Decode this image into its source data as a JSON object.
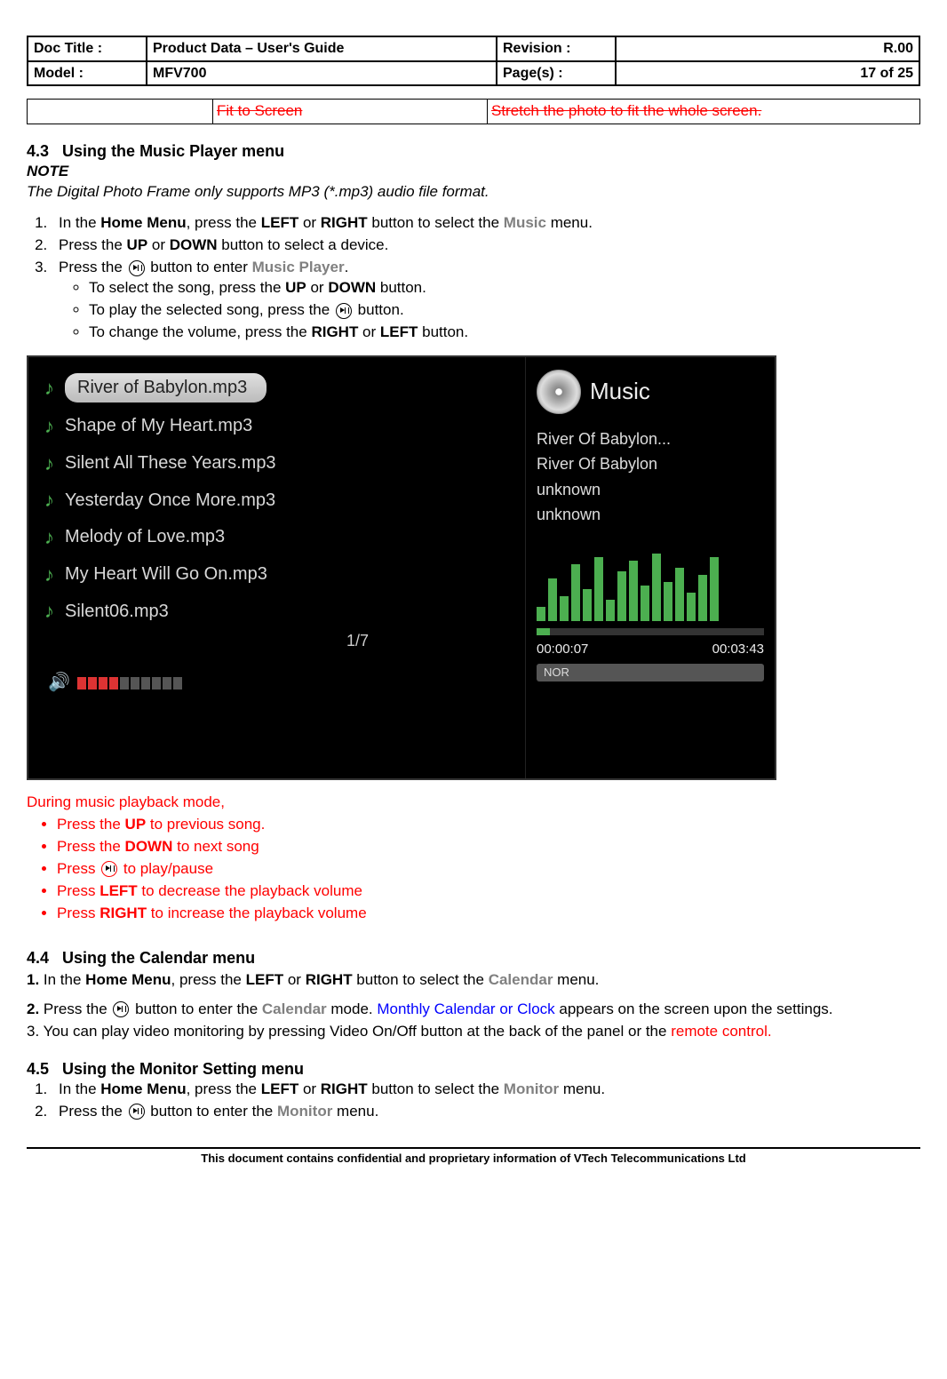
{
  "header": {
    "docTitleLbl": "Doc Title    :",
    "docTitleVal": "Product Data – User's Guide",
    "modelLbl": "Model         :",
    "modelVal": "MFV700",
    "revLbl": "Revision  :",
    "revVal": "R.00",
    "pagesLbl": "Page(s)   :",
    "pagesVal": "17 of 25"
  },
  "fitTable": {
    "col1": " ",
    "col2": "Fit to Screen",
    "col3": "Stretch the photo to fit the whole screen."
  },
  "s43": {
    "title_num": "4.3",
    "title_rest_a": "Using ",
    "title_rest_b": "the Music Player menu",
    "noteHead": "NOTE",
    "noteBody": "The Digital Photo Frame only supports MP3 (*.mp3) audio file format.",
    "step1_a": "In the ",
    "step1_b": "Home Menu",
    "step1_c": ", press the ",
    "step1_d": "LEFT",
    "step1_e": " or ",
    "step1_f": "RIGHT",
    "step1_g": " button to select the ",
    "step1_h": "Music",
    "step1_i": " menu.",
    "step2_a": "Press the ",
    "step2_b": "UP",
    "step2_c": " or ",
    "step2_d": "DOWN",
    "step2_e": " button to select a device.",
    "step3_a": "Press the ",
    "step3_b": " button to enter ",
    "step3_c": "Music Player",
    "step3_d": ".",
    "b1_a": "To select the song, press the ",
    "b1_b": "UP",
    "b1_c": " or ",
    "b1_d": "DOWN",
    "b1_e": " button.",
    "b2_a": "To play the selected song, press the ",
    "b2_b": " button.",
    "b3_a": "To change the volume, press the ",
    "b3_b": "RIGHT",
    "b3_c": " or ",
    "b3_d": "LEFT",
    "b3_e": " button."
  },
  "player": {
    "songs": [
      "River of Babylon.mp3",
      "Shape of My Heart.mp3",
      "Silent All These Years.mp3",
      "Yesterday Once More.mp3",
      "Melody of Love.mp3",
      "My Heart Will Go On.mp3",
      "Silent06.mp3"
    ],
    "pageInd": "1/7",
    "panelTitle": "Music",
    "info1": "River Of Babylon...",
    "info2": "River Of Babylon",
    "info3": "unknown",
    "info4": "unknown",
    "t_elapsed": "00:00:07",
    "t_total": "00:03:43",
    "mode": "NOR"
  },
  "during": {
    "lead": "During music playback mode,",
    "b1_a": "Press the ",
    "b1_b": "UP",
    "b1_c": " to previous song.",
    "b2_a": "Press the ",
    "b2_b": "DOWN",
    "b2_c": " to next song",
    "b3_a": "Press ",
    "b3_b": " to play/pause",
    "b4_a": "Press ",
    "b4_b": "LEFT",
    "b4_c": " to decrease the playback volume",
    "b5_a": "Press ",
    "b5_b": "RIGHT",
    "b5_c": " to increase the playback volume"
  },
  "s44": {
    "title_num": "4.4",
    "title_rest": "Using the Calendar menu",
    "l1_a": "1. ",
    "l1_b": "In the ",
    "l1_c": "Home Menu",
    "l1_d": ", press the ",
    "l1_e": "LEFT",
    "l1_f": " or ",
    "l1_g": "RIGHT",
    "l1_h": " button to select the ",
    "l1_i": "Calendar",
    "l1_j": " menu.",
    "l2_a": "2. ",
    "l2_b": "Press the ",
    "l2_c": " button to enter the ",
    "l2_d": "Calendar",
    "l2_e": " mode. ",
    "l2_f": "Monthly Calendar or Clock",
    "l2_g": " appears on the screen upon the settings.",
    "l3_a": "3. You can play video monitoring by pressing Video On/Off button at the back of the panel or the ",
    "l3_b": "remote control."
  },
  "s45": {
    "title_num": "4.5",
    "title_rest": "Using the Monitor Setting menu",
    "l1_a": "In the ",
    "l1_b": "Home Menu",
    "l1_c": ", press the ",
    "l1_d": "LEFT",
    "l1_e": " or ",
    "l1_f": "RIGHT",
    "l1_g": " button to select the ",
    "l1_h": "Monitor",
    "l1_i": " menu.",
    "l2_a": "Press the ",
    "l2_b": " button to enter the ",
    "l2_c": "Monitor",
    "l2_d": " menu."
  },
  "footer": "This document contains confidential and proprietary information of VTech Telecommunications Ltd"
}
